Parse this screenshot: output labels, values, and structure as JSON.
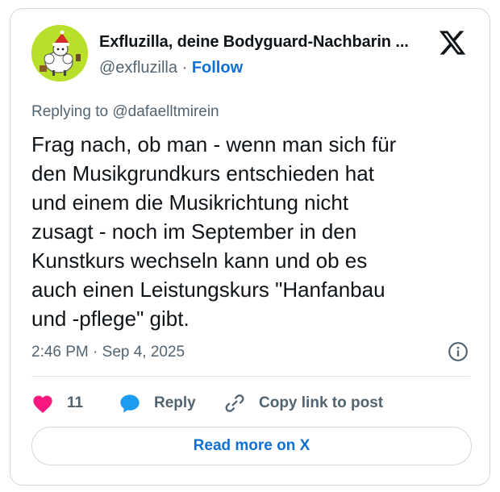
{
  "author": {
    "display_name": "Exfluzilla, deine Bodyguard-Nachbarin ...",
    "handle": "@exfluzilla",
    "separator": "·",
    "follow_label": "Follow",
    "avatar_icon": "sheep-with-santa-hat-avatar"
  },
  "platform_icon": "x-logo-icon",
  "reply_context": "Replying to @dafaelltmirein",
  "tweet_lines": [
    "Frag nach, ob man - wenn man sich für",
    "den Musikgrundkurs entschieden hat",
    "und einem die Musikrichtung nicht",
    "zusagt - noch im September in den",
    "Kunstkurs wechseln kann und ob es",
    "auch einen Leistungskurs \"Hanfanbau",
    "und -pflege\" gibt."
  ],
  "timestamp": "2:46 PM · Sep 4, 2025",
  "actions": {
    "like_count": "11",
    "reply_label": "Reply",
    "copy_label": "Copy link to post"
  },
  "read_more_label": "Read more on X",
  "colors": {
    "accent": "#0f6fd3",
    "like": "#f91880",
    "reply_icon": "#1d9bf0",
    "text": "#0f1419",
    "muted": "#536471",
    "border": "#cfd9de"
  }
}
